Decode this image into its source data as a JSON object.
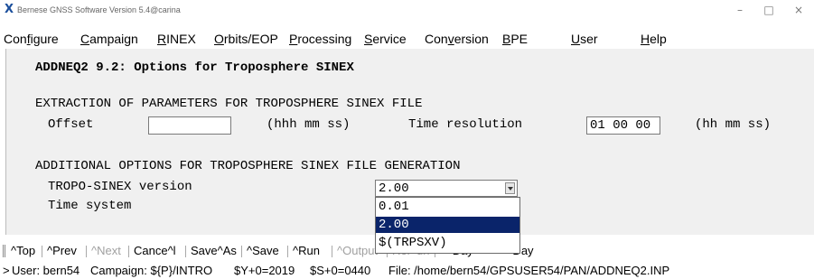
{
  "window": {
    "title": "Bernese GNSS Software Version 5.4@carina",
    "minimize": "–",
    "maximize": "□",
    "close": "×"
  },
  "menu": [
    {
      "pre": "Con",
      "u": "f",
      "post": "igure"
    },
    {
      "pre": "",
      "u": "C",
      "post": "ampaign"
    },
    {
      "pre": "",
      "u": "R",
      "post": "INEX"
    },
    {
      "pre": "",
      "u": "O",
      "post": "rbits/EOP"
    },
    {
      "pre": "",
      "u": "P",
      "post": "rocessing"
    },
    {
      "pre": "",
      "u": "S",
      "post": "ervice"
    },
    {
      "pre": "Con",
      "u": "v",
      "post": "ersion"
    },
    {
      "pre": "",
      "u": "B",
      "post": "PE"
    },
    {
      "pre": "",
      "u": "U",
      "post": "ser"
    },
    {
      "pre": "",
      "u": "H",
      "post": "elp"
    }
  ],
  "panel": {
    "title": "ADDNEQ2 9.2: Options for Troposphere SINEX",
    "section1": {
      "heading": "EXTRACTION OF PARAMETERS FOR TROPOSPHERE SINEX FILE",
      "offset_label": "Offset",
      "offset_value": "",
      "offset_units": "(hhh mm ss)",
      "time_resolution_label": "Time resolution",
      "time_resolution_value": "01 00 00",
      "time_resolution_units": "(hh mm ss)"
    },
    "section2": {
      "heading": "ADDITIONAL OPTIONS FOR TROPOSPHERE SINEX FILE GENERATION",
      "tropo_label": "TROPO-SINEX version",
      "tropo_selected": "2.00",
      "tropo_options": [
        "0.01",
        "2.00",
        "$(TRPSXV)"
      ],
      "time_system_label": "Time system"
    }
  },
  "toolbar": {
    "top": "^Top",
    "prev": "^Prev",
    "next": "^Next",
    "cancel": "Cance^l",
    "saveas": "Save^As",
    "save": "^Save",
    "run": "^Run",
    "output": "^Output",
    "rerun": "Rer^un",
    "plus_day": "^+Day",
    "minus_day": "^-Day"
  },
  "statusbar": {
    "prompt": ">",
    "user": "User: bern54",
    "campaign": "Campaign: ${P}/INTRO",
    "year": "$Y+0=2019",
    "session": "$S+0=0440",
    "file": "File: /home/bern54/GPSUSER54/PAN/ADDNEQ2.INP"
  }
}
